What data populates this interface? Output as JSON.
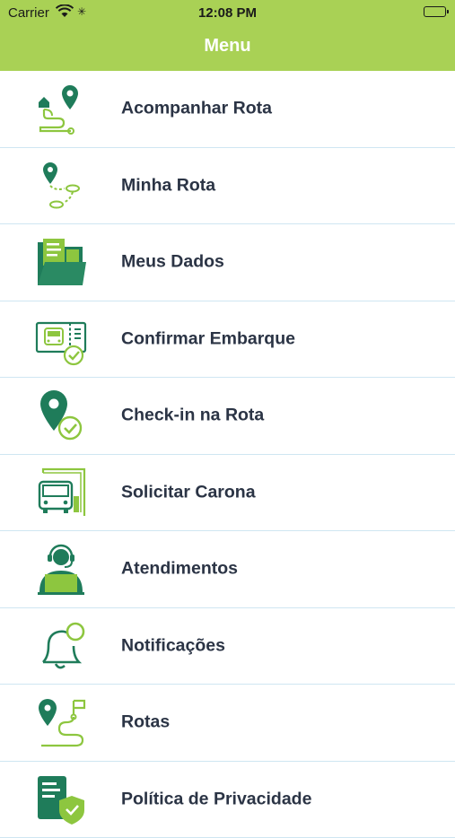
{
  "status_bar": {
    "carrier": "Carrier",
    "time": "12:08 PM"
  },
  "header": {
    "title": "Menu"
  },
  "colors": {
    "header_bg": "#a9d155",
    "icon_dark": "#1f7c5a",
    "icon_light": "#8dc63f",
    "label_text": "#2b3445",
    "separator": "#cfe6f2"
  },
  "menu": {
    "items": [
      {
        "label": "Acompanhar Rota",
        "icon": "route-tracking-icon"
      },
      {
        "label": "Minha Rota",
        "icon": "my-route-icon"
      },
      {
        "label": "Meus Dados",
        "icon": "folder-data-icon"
      },
      {
        "label": "Confirmar Embarque",
        "icon": "bus-ticket-check-icon"
      },
      {
        "label": "Check-in na Rota",
        "icon": "location-check-icon"
      },
      {
        "label": "Solicitar Carona",
        "icon": "bus-request-icon"
      },
      {
        "label": "Atendimentos",
        "icon": "support-agent-icon"
      },
      {
        "label": "Notificações",
        "icon": "bell-icon"
      },
      {
        "label": "Rotas",
        "icon": "routes-icon"
      },
      {
        "label": "Política de Privacidade",
        "icon": "privacy-shield-icon"
      }
    ]
  }
}
